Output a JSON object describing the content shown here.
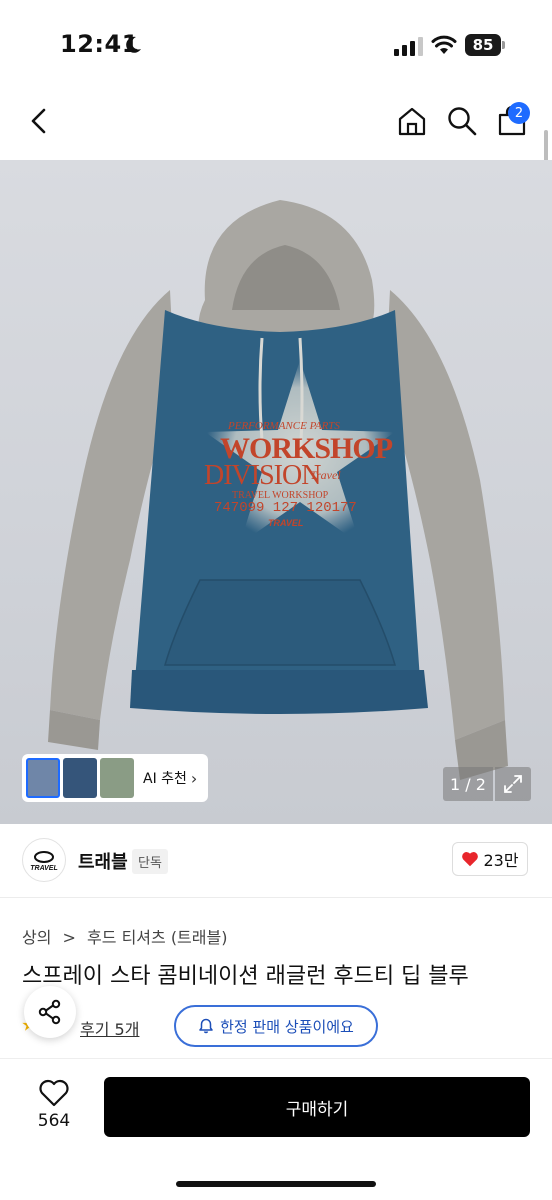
{
  "status": {
    "time": "12:41",
    "battery": "85",
    "icons": [
      "moon-icon",
      "signal-icon",
      "wifi-icon"
    ]
  },
  "nav": {
    "cart_count": "2",
    "icons": [
      "back-icon",
      "home-icon",
      "search-icon",
      "bag-icon"
    ]
  },
  "image": {
    "ai_label": "AI 추천",
    "ai_chevron": "›",
    "counter": "1 / 2",
    "print": {
      "line1": "PERFORMANCE  PARTS",
      "line2": "WORKSHOP",
      "line3": "DIVISION",
      "line3b": "Travel",
      "line4": "TRAVEL WORKSHOP",
      "line5": "747099 127 120177",
      "logo": "TRAVEL"
    },
    "colors": {
      "body": "#2f6183",
      "sleeve": "#a9a7a2",
      "print_red": "#c2452b"
    }
  },
  "brand": {
    "name": "트래블",
    "tag": "단독",
    "logo_text": "TRAVEL",
    "likes": "23만"
  },
  "product": {
    "breadcrumb_1": "상의",
    "breadcrumb_sep": ">",
    "breadcrumb_2": "후드 티셔츠 (트래블)",
    "title": "스프레이 스타 콤비네이션 래글런 후드티 딥 블루",
    "review": "후기 5개",
    "limited": "한정 판매 상품이에요"
  },
  "bottom": {
    "wish_count": "564",
    "buy_label": "구매하기"
  }
}
